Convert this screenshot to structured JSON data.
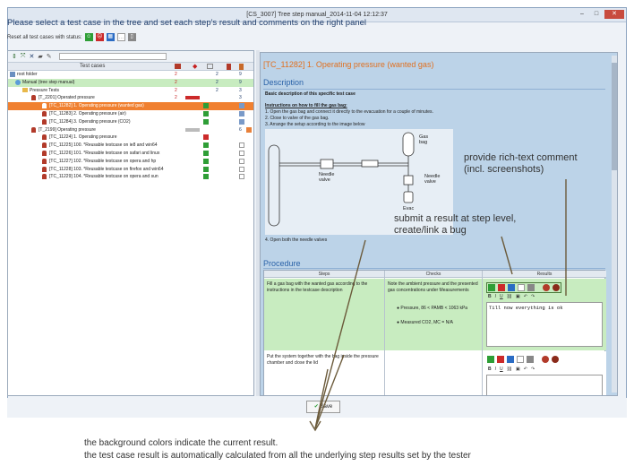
{
  "window": {
    "title": "[CS_3007] Tree step manual_2014-11-04 12:12:37",
    "controls": {
      "minimize": "–",
      "maximize": "□",
      "close": "✕"
    }
  },
  "instruction": "Please select a test case in the tree and set each step's result and comments on the right panel",
  "reset_label": "Reset all test cases with status:",
  "left_panel": {
    "column_header": "Test cases",
    "rows": [
      {
        "label": "root folder",
        "indent": 0,
        "n1": "2",
        "n2": "2",
        "n3": "9"
      },
      {
        "label": "Manual (tree step manual)",
        "indent": 1,
        "n1": "2",
        "n2": "2",
        "n3": "9"
      },
      {
        "label": "Pressure Tests",
        "indent": 2,
        "n1": "2",
        "n2": "2",
        "n3": "3"
      },
      {
        "label": "[T_2201] Operated pressure",
        "indent": 3,
        "n1": "2",
        "n2": "",
        "n3": "3"
      },
      {
        "label": "[TC_11282] 1. Operating pressure (wanted gas)",
        "indent": 4,
        "n1": "",
        "n2": "",
        "n3": ""
      },
      {
        "label": "[TC_11283] 2. Operating pressure (air)",
        "indent": 4,
        "n1": "",
        "n2": "",
        "n3": ""
      },
      {
        "label": "[TC_11284] 3. Operating pressure (CO2)",
        "indent": 4,
        "n1": "",
        "n2": "",
        "n3": ""
      },
      {
        "label": "[T_2199] Operating pressure",
        "indent": 3,
        "n1": "",
        "n2": "",
        "n3": "6"
      },
      {
        "label": "[TC_11224] 1. Operating pressure",
        "indent": 4,
        "n1": "",
        "n2": "",
        "n3": ""
      },
      {
        "label": "[TC_11225] 100. *Reusable testcase on ie8 and win64",
        "indent": 4,
        "n1": "",
        "n2": "",
        "n3": ""
      },
      {
        "label": "[TC_11226] 101. *Reusable testcase on safari and linux",
        "indent": 4,
        "n1": "",
        "n2": "",
        "n3": ""
      },
      {
        "label": "[TC_11227] 102. *Reusable testcase on opera and hp",
        "indent": 4,
        "n1": "",
        "n2": "",
        "n3": ""
      },
      {
        "label": "[TC_11228] 103. *Reusable testcase on firefox and win64",
        "indent": 4,
        "n1": "",
        "n2": "",
        "n3": ""
      },
      {
        "label": "[TC_11229] 104. *Reusable testcase on opera and sun",
        "indent": 4,
        "n1": "",
        "n2": "",
        "n3": ""
      }
    ]
  },
  "right_panel": {
    "tc_title": "[TC_11282] 1. Operating pressure (wanted gas)",
    "description_heading": "Description",
    "description_basic": "Basic description of this specific test case",
    "instructions_heading": "Instructions on how to fill the gas bag:",
    "instructions": [
      "1. Open the gas bag and connect it directly to the evacuation for a couple of minutes.",
      "2. Close to valve of the gas bag.",
      "3. Arrange the setup according to the image below"
    ],
    "diagram": {
      "gas_bag": "Gas bag",
      "needle_valve": "Needle valve",
      "evac": "Evac"
    },
    "step4": "4. Open both the needle valves",
    "procedure_heading": "Procedure",
    "columns": {
      "steps": "Steps",
      "checks": "Checks",
      "results": "Results"
    },
    "step1_text": "Fill a gas bag with the wanted gas according to the instructions in the testcase description",
    "step1_checks_intro": "Note the ambient pressure and the presented gas concentrations under Measurements",
    "step1_checks": [
      "Pressure, 86 < PAMB < 1063 kPa",
      "Measured CO2, MC = N/A"
    ],
    "step1_comment": "Till now everything is ok",
    "step2_text": "Put the system together with the bag inside the pressure chamber and close the lid"
  },
  "save_label": "Save",
  "annotations": {
    "rich_text": "provide rich-text comment\n(incl. screenshots)",
    "submit": "submit a result at step level,\ncreate/link a bug",
    "bg_line1": "the background colors indicate the current result.",
    "bg_line2": "the test case result is automatically calculated from all the underlying step results set by the tester"
  },
  "colors": {
    "selected_row": "#f08030",
    "passed_bg": "#c8ecc0",
    "panel_bg": "#bcd3e8",
    "title_orange": "#e07020",
    "heading_blue": "#2a62a8"
  }
}
